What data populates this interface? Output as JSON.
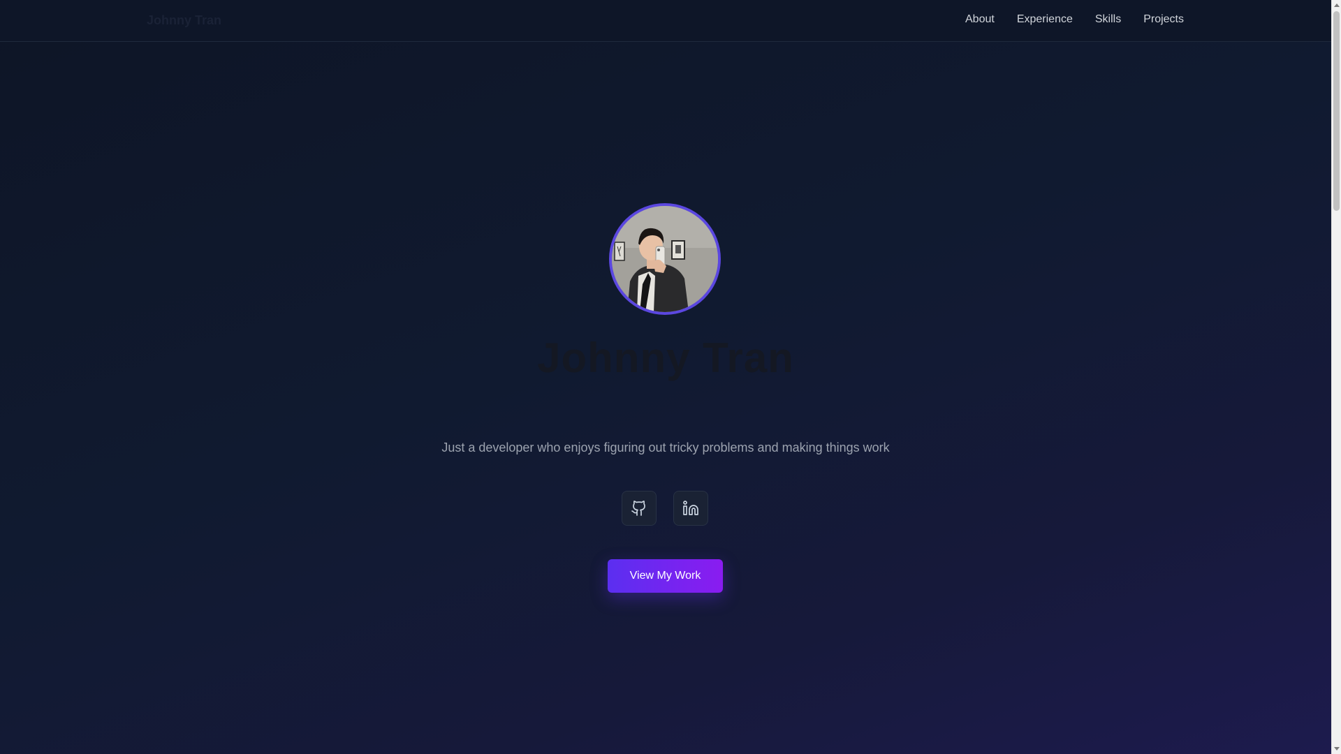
{
  "brand": {
    "name": "Johnny Tran"
  },
  "nav": {
    "items": [
      {
        "label": "About"
      },
      {
        "label": "Experience"
      },
      {
        "label": "Skills"
      },
      {
        "label": "Projects"
      }
    ]
  },
  "hero": {
    "name": "Johnny Tran",
    "tagline": "Just a developer who enjoys figuring out tricky problems and making things work",
    "cta_label": "View My Work"
  },
  "socials": [
    {
      "icon": "github-icon"
    },
    {
      "icon": "linkedin-icon"
    }
  ],
  "colors": {
    "accent": "#6d28d9",
    "avatar_ring": "#5b47e0",
    "background": "#101a30"
  }
}
